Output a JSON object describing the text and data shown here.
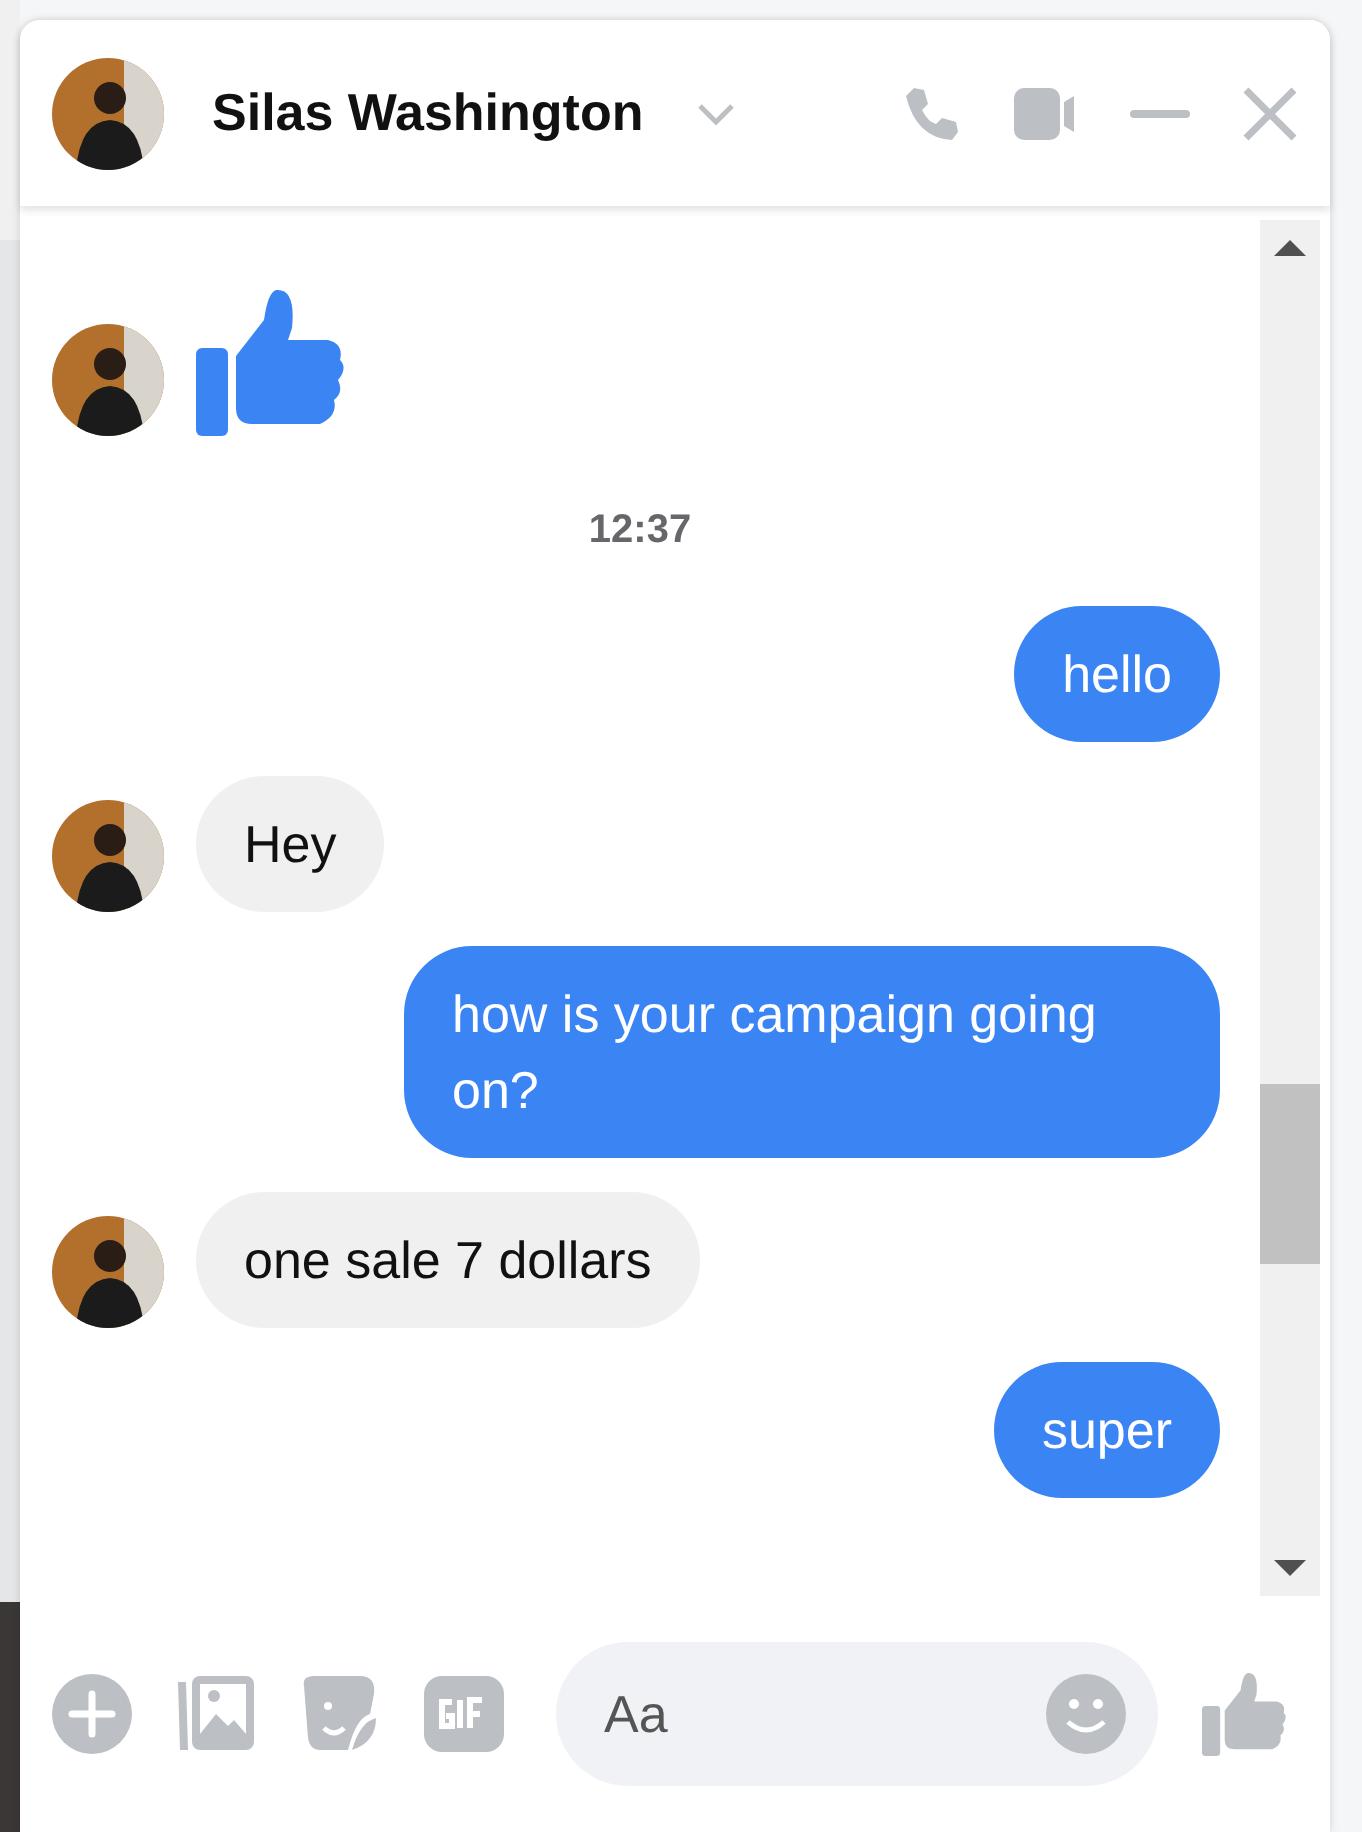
{
  "header": {
    "name": "Silas Washington"
  },
  "messages": [
    {
      "kind": "like"
    },
    {
      "kind": "time",
      "text": "12:37"
    },
    {
      "kind": "sent",
      "text": "hello"
    },
    {
      "kind": "received",
      "text": "Hey"
    },
    {
      "kind": "sent",
      "text": "how is your campaign going on?"
    },
    {
      "kind": "received",
      "text": "one sale 7 dollars"
    },
    {
      "kind": "sent",
      "text": "super"
    }
  ],
  "composer": {
    "placeholder": "Aa"
  }
}
